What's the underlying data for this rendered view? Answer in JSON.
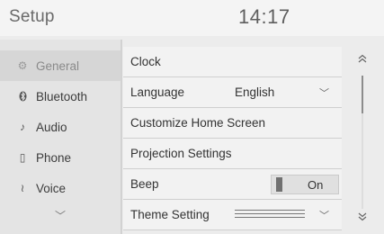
{
  "header": {
    "title": "Setup",
    "clock": "14:17"
  },
  "sidebar": {
    "items": [
      {
        "label": "General",
        "icon": "gear-icon",
        "glyph": "⚙",
        "active": true
      },
      {
        "label": "Bluetooth",
        "icon": "bluetooth-icon",
        "glyph": "ʙ",
        "active": false
      },
      {
        "label": "Audio",
        "icon": "music-note-icon",
        "glyph": "♪",
        "active": false
      },
      {
        "label": "Phone",
        "icon": "phone-icon",
        "glyph": "▯",
        "active": false
      },
      {
        "label": "Voice",
        "icon": "voice-icon",
        "glyph": "≀",
        "active": false
      }
    ],
    "more_glyph": "﹀"
  },
  "list": {
    "rows": [
      {
        "label": "Clock"
      },
      {
        "label": "Language",
        "value": "English",
        "chevron": "﹀"
      },
      {
        "label": "Customize Home Screen"
      },
      {
        "label": "Projection Settings"
      },
      {
        "label": "Beep",
        "toggle_text": "On",
        "toggle_state": "on"
      },
      {
        "label": "Theme Setting",
        "chevron": "﹀"
      }
    ]
  },
  "scroll": {
    "up_glyph": "⌃",
    "down_glyph": "⌄"
  },
  "colors": {
    "background": "#ececec",
    "header": "#f4f4f4",
    "sidebar": "#e4e4e4",
    "active_item": "#d6d6d6"
  }
}
